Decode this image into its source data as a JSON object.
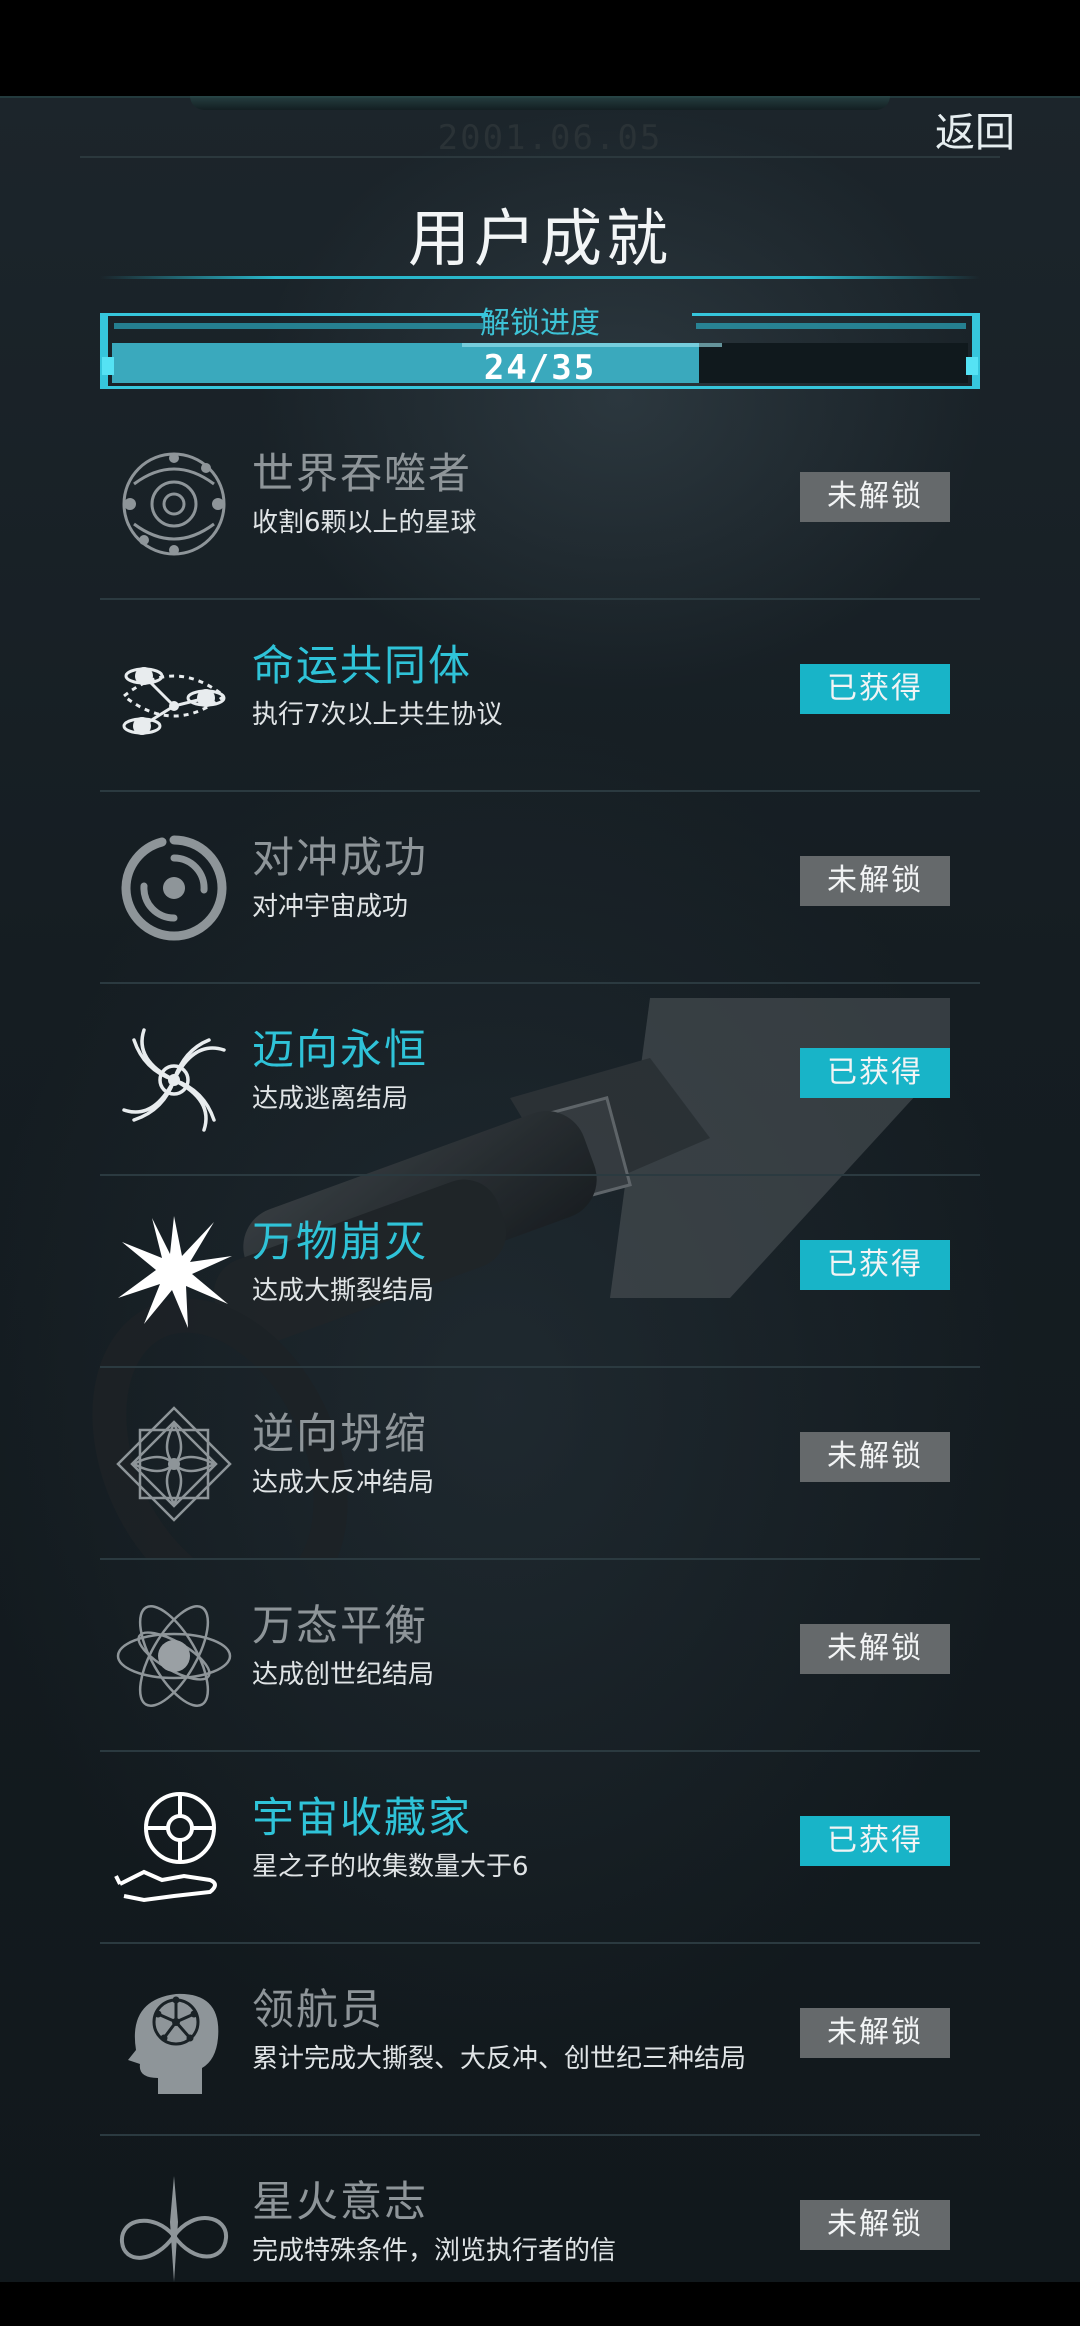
{
  "header": {
    "date": "2001.06.05",
    "back_label": "返回",
    "title": "用户成就"
  },
  "progress": {
    "label": "解锁进度",
    "text": "24/35",
    "unlocked": 24,
    "total": 35
  },
  "achievements": [
    {
      "name": "世界吞噬者",
      "desc": "收割6颗以上的星球",
      "status": "未解锁",
      "unlocked": false,
      "icon": "planet-orbit-icon"
    },
    {
      "name": "命运共同体",
      "desc": "执行7次以上共生协议",
      "status": "已获得",
      "unlocked": true,
      "icon": "linked-planets-icon"
    },
    {
      "name": "对冲成功",
      "desc": "对冲宇宙成功",
      "status": "未解锁",
      "unlocked": false,
      "icon": "swirl-icon"
    },
    {
      "name": "迈向永恒",
      "desc": "达成逃离结局",
      "status": "已获得",
      "unlocked": true,
      "icon": "galaxy-spiral-icon"
    },
    {
      "name": "万物崩灭",
      "desc": "达成大撕裂结局",
      "status": "已获得",
      "unlocked": true,
      "icon": "burst-icon"
    },
    {
      "name": "逆向坍缩",
      "desc": "达成大反冲结局",
      "status": "未解锁",
      "unlocked": false,
      "icon": "mandala-icon"
    },
    {
      "name": "万态平衡",
      "desc": "达成创世纪结局",
      "status": "未解锁",
      "unlocked": false,
      "icon": "atom-orbit-icon"
    },
    {
      "name": "宇宙收藏家",
      "desc": "星之子的收集数量大于6",
      "status": "已获得",
      "unlocked": true,
      "icon": "hand-globe-icon"
    },
    {
      "name": "领航员",
      "desc": "累计完成大撕裂、大反冲、创世纪三种结局",
      "status": "未解锁",
      "unlocked": false,
      "icon": "brain-head-icon"
    },
    {
      "name": "星火意志",
      "desc": "完成特殊条件，浏览执行者的信",
      "status": "未解锁",
      "unlocked": false,
      "icon": "infinity-spark-icon"
    }
  ],
  "colors": {
    "accent": "#2fc3d8",
    "badge_unlocked": "#18b4c8",
    "badge_locked": "#65696b"
  }
}
